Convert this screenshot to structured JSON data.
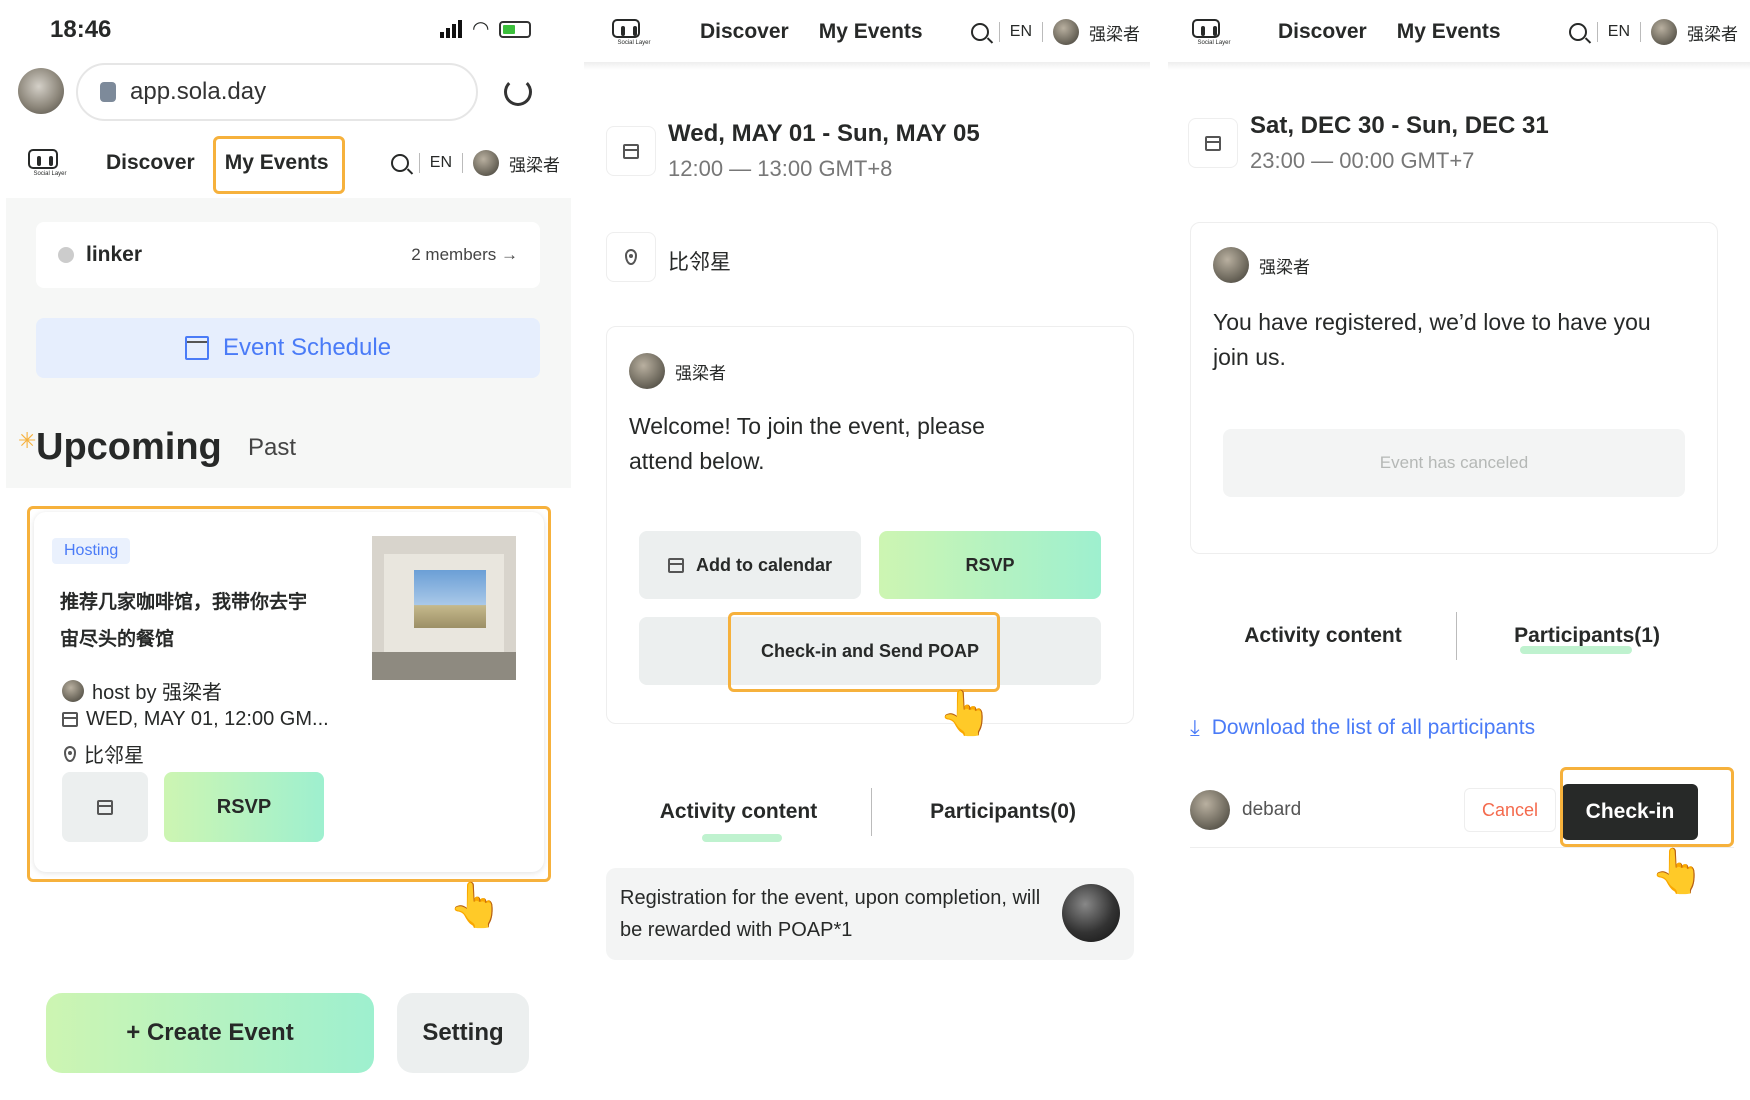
{
  "colors": {
    "highlight": "#F6B13C",
    "accent_blue": "#4A7BF7",
    "cancel_red": "#F46A4D",
    "dark_btn": "#272928"
  },
  "left": {
    "status_time": "18:46",
    "url": "app.sola.day",
    "logo_caption": "Social Layer",
    "nav": {
      "discover": "Discover",
      "my_events": "My Events",
      "lang": "EN",
      "user": "强梁者"
    },
    "group": {
      "name": "linker",
      "members": "2 members →"
    },
    "schedule_label": "Event Schedule",
    "tabs": {
      "upcoming": "Upcoming",
      "past": "Past"
    },
    "card": {
      "badge": "Hosting",
      "title_line1": "推荐几家咖啡馆，我带你去宇",
      "title_line2": "宙尽头的餐馆",
      "host": "host by 强梁者",
      "date": "WED, MAY 01, 12:00 GM...",
      "location": "比邻星",
      "rsvp": "RSVP"
    },
    "create_event": "+ Create Event",
    "setting": "Setting"
  },
  "mid": {
    "logo_caption": "Social Layer",
    "nav": {
      "discover": "Discover",
      "my_events": "My Events",
      "lang": "EN",
      "user": "强梁者"
    },
    "date_range": "Wed, MAY 01 - Sun, MAY 05",
    "time_range": "12:00 — 13:00 GMT+8",
    "location": "比邻星",
    "host_name": "强梁者",
    "welcome": "Welcome! To join the event, please attend below.",
    "add_calendar": "Add to calendar",
    "rsvp": "RSVP",
    "checkin_send": "Check-in and Send POAP",
    "tab_activity": "Activity content",
    "tab_participants": "Participants(0)",
    "poap_note": "Registration for the event, upon completion, will be rewarded with POAP*1"
  },
  "right": {
    "logo_caption": "Social Layer",
    "nav": {
      "discover": "Discover",
      "my_events": "My Events",
      "lang": "EN",
      "user": "强梁者"
    },
    "date_range": "Sat, DEC 30 - Sun, DEC 31",
    "time_range": "23:00 — 00:00 GMT+7",
    "host_name": "强梁者",
    "registered_msg": "You have registered, we’d love to have you join us.",
    "canceled": "Event has canceled",
    "tab_activity": "Activity content",
    "tab_participants": "Participants(1)",
    "download": "Download the list of all participants",
    "participant": "debard",
    "cancel": "Cancel",
    "checkin": "Check-in"
  }
}
